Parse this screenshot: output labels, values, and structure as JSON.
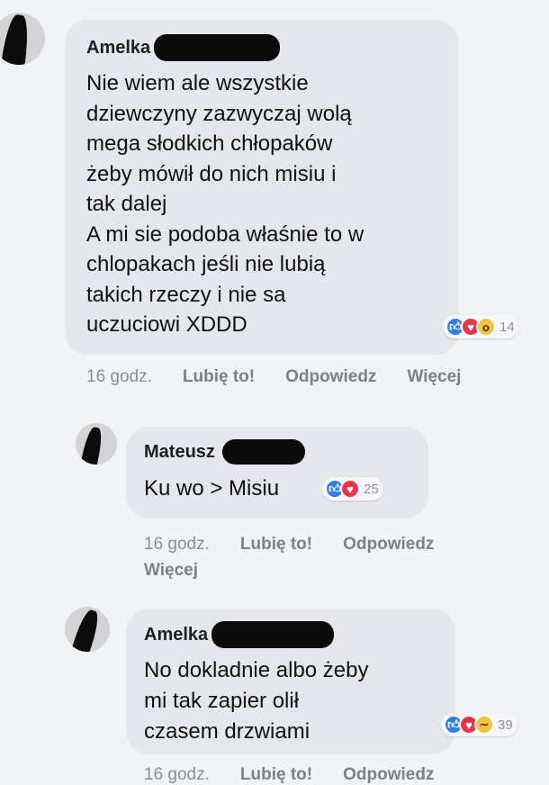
{
  "comments": [
    {
      "author": "Amelka",
      "lines": [
        "Nie wiem ale wszystkie",
        "dziewczyny zazwyczaj wolą",
        "mega słodkich chłopaków",
        "żeby mówił do nich misiu i",
        "tak dalej",
        "A mi sie podoba właśnie to w",
        "chlopakach jeśli nie lubią",
        "takich rzeczy i nie sa",
        "uczuciowi XDDD"
      ],
      "reactions": {
        "icons": [
          "like-icon",
          "love-icon",
          "wow-icon"
        ],
        "count": "14"
      },
      "time": "16 godz.",
      "like": "Lubię to!",
      "reply": "Odpowiedz",
      "more": "Więcej"
    },
    {
      "author": "Mateusz",
      "lines": [
        "Ku  wo > Misiu"
      ],
      "reactions": {
        "icons": [
          "like-icon",
          "love-icon"
        ],
        "count": "25"
      },
      "time": "16 godz.",
      "like": "Lubię to!",
      "reply": "Odpowiedz",
      "more": "Więcej"
    },
    {
      "author": "Amelka",
      "lines": [
        "No dokladnie albo żeby",
        "mi tak zapier    olił",
        "czasem drzwiami"
      ],
      "reactions": {
        "icons": [
          "like-icon",
          "love-icon",
          "haha-icon"
        ],
        "count": "39"
      },
      "time": "16 godz.",
      "like": "Lubię to!",
      "reply": "Odpowiedz"
    }
  ]
}
